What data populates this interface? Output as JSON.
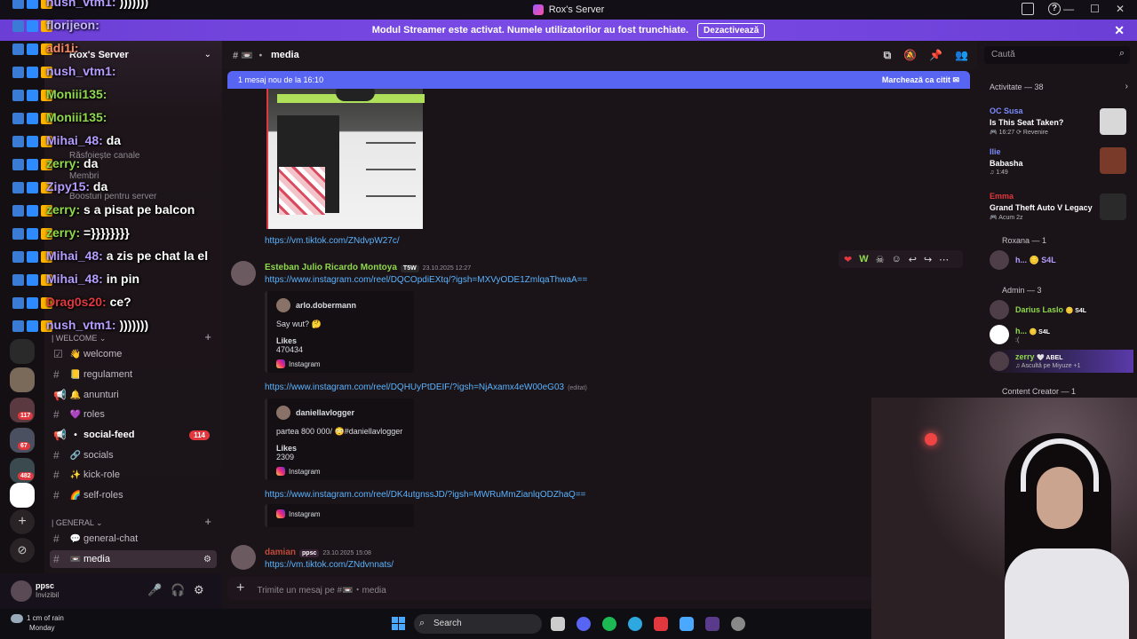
{
  "window": {
    "title": "Rox's Server"
  },
  "banner": {
    "text": "Modul Streamer este activat. Numele utilizatorilor au fost trunchiate.",
    "button": "Dezactivează"
  },
  "server": {
    "name": "Rox's Server",
    "menu_ghost": [
      "Răsfoiește canale",
      "Membri",
      "Boosturi pentru server"
    ],
    "categories": {
      "welcome": "| WELCOME",
      "general": "| GENERAL"
    },
    "channels": [
      {
        "name": "welcome",
        "emoji": "👋",
        "type": "text"
      },
      {
        "name": "regulament",
        "emoji": "📒",
        "type": "text"
      },
      {
        "name": "anunturi",
        "emoji": "🔔",
        "type": "announce"
      },
      {
        "name": "roles",
        "emoji": "💜",
        "type": "text"
      },
      {
        "name": "social-feed",
        "emoji": "•",
        "type": "announce",
        "badge": "114"
      },
      {
        "name": "socials",
        "emoji": "🔗",
        "type": "text"
      },
      {
        "name": "kick-role",
        "emoji": "✨",
        "type": "text"
      },
      {
        "name": "self-roles",
        "emoji": "🌈",
        "type": "text"
      }
    ],
    "general_channels": [
      {
        "name": "general-chat",
        "emoji": "💬"
      },
      {
        "name": "media",
        "emoji": "📼",
        "active": true
      }
    ],
    "rail_badges": [
      "117",
      "67",
      "482"
    ]
  },
  "user": {
    "name": "ppsc",
    "status": "Invizibil"
  },
  "overlay_chat": [
    {
      "user": "nush_vtm1:",
      "text": " )))))))",
      "color": "#b59cff"
    },
    {
      "user": "florijeon:",
      "text": "",
      "color": "#c7b8ff"
    },
    {
      "user": "adi1i:",
      "text": "",
      "color": "#ff8a5c"
    },
    {
      "user": "nush_vtm1:",
      "text": "",
      "color": "#b59cff"
    },
    {
      "user": "Moniii135:",
      "text": "",
      "color": "#8fd94b"
    },
    {
      "user": "Moniii135:",
      "text": "",
      "color": "#8fd94b"
    },
    {
      "user": "Mihai_48:",
      "text": " da",
      "color": "#b59cff"
    },
    {
      "user": "zerry:",
      "text": " da",
      "color": "#8fd94b"
    },
    {
      "user": "Zipy15:",
      "text": " da",
      "color": "#b59cff"
    },
    {
      "user": "zerry:",
      "text": " s a pisat pe balcon",
      "color": "#8fd94b"
    },
    {
      "user": "zerry:",
      "text": " =}}}}}}}}",
      "color": "#8fd94b"
    },
    {
      "user": "Mihai_48:",
      "text": " a zis pe chat la el",
      "color": "#b59cff"
    },
    {
      "user": "Mihai_48:",
      "text": " in pin",
      "color": "#b59cff"
    },
    {
      "user": "Drag0s20:",
      "text": " ce?",
      "color": "#e0383e"
    },
    {
      "user": "nush_vtm1:",
      "text": " )))))))",
      "color": "#b59cff"
    }
  ],
  "chat": {
    "channel": "media",
    "new_messages": "1 mesaj nou de la 16:10",
    "mark_read": "Marchează ca citit",
    "messages": {
      "link1": "https://vm.tiktok.com/ZNdvpW27c/",
      "author1": {
        "name": "Esteban Julio Ricardo Montoya",
        "tag": "T5W",
        "date": "23.10.2025 12:27"
      },
      "link2": "https://www.instagram.com/reel/DQCOpdiEXtq/?igsh=MXVyODE1ZmlqaThwaA==",
      "embed1": {
        "author": "arlo.dobermann",
        "text": "Say wut? 🤔",
        "likes_label": "Likes",
        "likes": "470434",
        "source": "Instagram"
      },
      "link3": "https://www.instagram.com/reel/DQHUyPtDEIF/?igsh=NjAxamx4eW00eG03",
      "edited": "(editat)",
      "embed2": {
        "author": "daniellavlogger",
        "text": "partea 800 000/ 😳#daniellavlogger",
        "likes_label": "Likes",
        "likes": "2309",
        "source": "Instagram"
      },
      "link4": "https://www.instagram.com/reel/DK4utgnssJD/?igsh=MWRuMmZianlqODZhaQ==",
      "embed3": {
        "source": "Instagram"
      },
      "author2": {
        "name": "damian",
        "tag": "ppsc",
        "date": "23.10.2025 15:08"
      },
      "link5": "https://vm.tiktok.com/ZNdvnnats/"
    },
    "composer_placeholder": "Trimite un mesaj pe #📼・media"
  },
  "search": {
    "placeholder": "Caută"
  },
  "members": {
    "activity_header": "Activitate — 38",
    "activities": [
      {
        "name": "OC Susa",
        "title": "Is This Seat Taken?",
        "sub": "🎮 16:27  ⟳ Revenire",
        "color": "#7b8cff"
      },
      {
        "name": "Ilie",
        "title": "Babasha",
        "sub": "♫ 1:49",
        "color": "#7b8cff"
      },
      {
        "name": "Emma",
        "title": "Grand Theft Auto V Legacy",
        "sub": "🎮 Acum 2z",
        "color": "#e0383e"
      }
    ],
    "roxana_header": "Roxana — 1",
    "roxana_member": "h... 🪙 S4L",
    "admin_header": "Admin — 3",
    "admins": [
      {
        "name": "Darius Laslo",
        "tag": "🪙 S4L",
        "sub": "",
        "color": "#8fd94b"
      },
      {
        "name": "h...",
        "tag": "🪙 S4L",
        "sub": ":(",
        "color": "#8fd94b"
      },
      {
        "name": "zerry",
        "tag": "🤍 ABEL",
        "sub": "♫ Ascultă pe Miyuze +1",
        "color": "#8fd94b"
      }
    ],
    "content_header": "Content Creator — 1"
  },
  "taskbar": {
    "weather_temp": "1 cm of rain",
    "weather_day": "Monday",
    "search": "Search"
  }
}
